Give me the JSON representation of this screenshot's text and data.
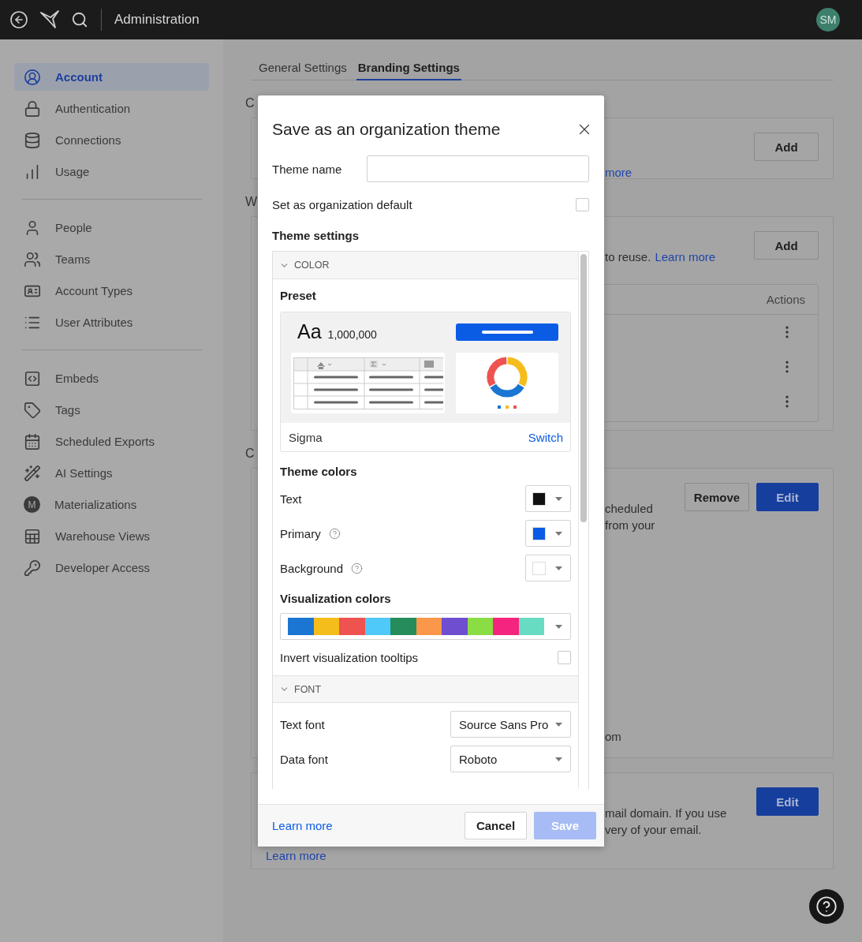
{
  "top_bar": {
    "title": "Administration",
    "avatar": "SM"
  },
  "sidebar": {
    "groups": [
      {
        "items": [
          {
            "label": "Account",
            "selected": true
          },
          {
            "label": "Authentication",
            "selected": false
          },
          {
            "label": "Connections",
            "selected": false
          },
          {
            "label": "Usage",
            "selected": false
          }
        ]
      },
      {
        "items": [
          {
            "label": "People",
            "selected": false
          },
          {
            "label": "Teams",
            "selected": false
          },
          {
            "label": "Account Types",
            "selected": false
          },
          {
            "label": "User Attributes",
            "selected": false
          }
        ]
      },
      {
        "items": [
          {
            "label": "Embeds",
            "selected": false
          },
          {
            "label": "Tags",
            "selected": false
          },
          {
            "label": "Scheduled Exports",
            "selected": false
          },
          {
            "label": "AI Settings",
            "selected": false
          },
          {
            "label": "Materializations",
            "selected": false,
            "icon_letter": "M"
          },
          {
            "label": "Warehouse Views",
            "selected": false
          },
          {
            "label": "Developer Access",
            "selected": false
          }
        ]
      }
    ]
  },
  "tabs": [
    {
      "label": "General Settings",
      "selected": false
    },
    {
      "label": "Branding Settings",
      "selected": true
    }
  ],
  "cards": [
    {
      "title": "C",
      "lines": [
        [
          {
            "text": "more",
            "link": true
          }
        ]
      ],
      "buttons": [
        {
          "label": "Add",
          "primary": false
        }
      ]
    },
    {
      "title": "W",
      "lines": [
        [
          {
            "text": "to reuse.",
            "link": false
          },
          {
            "text": "Learn more",
            "link": true
          }
        ]
      ],
      "buttons": [
        {
          "label": "Add",
          "primary": false
        }
      ],
      "table": {
        "header": "Actions",
        "rows": [
          {
            "menu": true
          },
          {
            "menu": true
          },
          {
            "menu": true
          }
        ]
      }
    },
    {
      "title": "C",
      "lines": [
        [
          {
            "text": "cheduled",
            "link": false
          }
        ],
        [
          {
            "text": "from your",
            "link": false
          }
        ]
      ],
      "bottom_line": [
        {
          "text": "om",
          "link": false
        }
      ],
      "buttons": [
        {
          "label": "Remove",
          "primary": false
        },
        {
          "label": "Edit",
          "primary": true
        }
      ]
    },
    {
      "lines": [
        [
          {
            "text": "mail domain. If you use",
            "link": false
          }
        ],
        [
          {
            "text": "very of your email.",
            "link": false
          }
        ]
      ],
      "bottom_line": [
        {
          "text": "Learn more",
          "link": true
        }
      ],
      "buttons": [
        {
          "label": "Edit",
          "primary": true
        }
      ]
    }
  ],
  "dialog": {
    "title": "Save as an organization theme",
    "theme_name": {
      "label": "Theme name"
    },
    "default_option": {
      "label": "Set as organization default",
      "checked": false
    },
    "settings_title": "Theme settings",
    "color_section": {
      "title": "COLOR",
      "expanded": true,
      "preset": {
        "label": "Preset",
        "sample_text": "Aa",
        "sample_number": "1,000,000",
        "name": "Sigma",
        "action": "Switch"
      },
      "theme_colors": {
        "label": "Theme colors",
        "items": [
          {
            "label": "Text",
            "help": false,
            "color": "#111111"
          },
          {
            "label": "Primary",
            "help": true,
            "color": "#0b5ce5"
          },
          {
            "label": "Background",
            "help": true,
            "color": "#ffffff"
          }
        ]
      },
      "visualization_colors": {
        "label": "Visualization colors",
        "colors": [
          {
            "color": "#1a76d2"
          },
          {
            "color": "#f5bd1c"
          },
          {
            "color": "#ef5350"
          },
          {
            "color": "#4fc9f9"
          },
          {
            "color": "#268c5c"
          },
          {
            "color": "#fa974a"
          },
          {
            "color": "#6f4ecf"
          },
          {
            "color": "#8ade43"
          },
          {
            "color": "#f5257f"
          },
          {
            "color": "#68dcc3"
          }
        ]
      },
      "invert_tooltips": {
        "label": "Invert visualization tooltips",
        "checked": false
      }
    },
    "font_section": {
      "title": "FONT",
      "expanded": true,
      "fields": [
        {
          "label": "Text font",
          "value": "Source Sans Pro"
        },
        {
          "label": "Data font",
          "value": "Roboto"
        }
      ]
    },
    "footer": {
      "link": "Learn more",
      "buttons": [
        {
          "label": "Cancel",
          "primary": false,
          "disabled": false
        },
        {
          "label": "Save",
          "primary": true,
          "disabled": true
        }
      ]
    }
  }
}
